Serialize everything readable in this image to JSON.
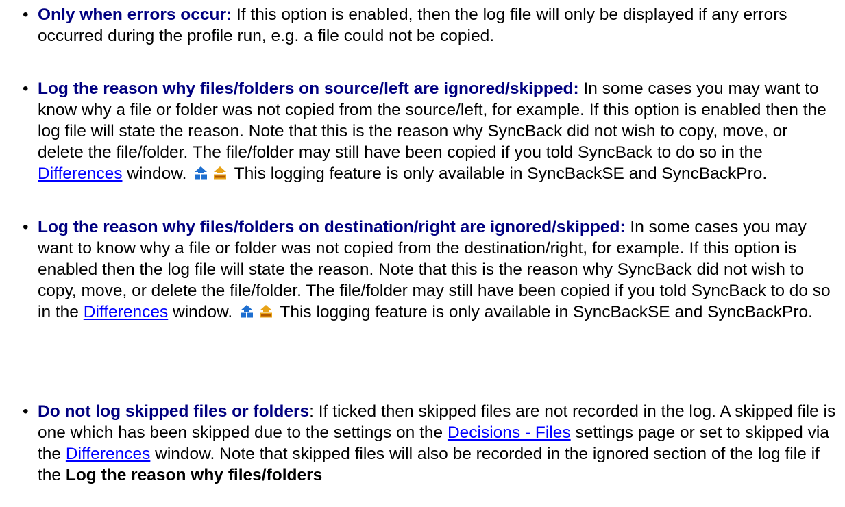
{
  "bullet_glyph": "•",
  "items": [
    {
      "term": "Only when errors occur:",
      "text1": " If this option is enabled, then the log file will only be displayed if any errors occurred during the profile run, e.g. a file could not be copied."
    },
    {
      "term": "Log the reason why files/folders on source/left are ignored/skipped:",
      "text1": " In some cases you may want to know why a file or folder was not copied from the source/left, for example. If this option is enabled then the log file will state the reason. Note that this is the reason why SyncBack did not wish to copy, move, or delete the file/folder. The file/folder may still have been copied if you told SyncBack to do so in the ",
      "link1": "Differences",
      "text2": " window. ",
      "text3": " This logging feature is only available in SyncBackSE and SyncBackPro."
    },
    {
      "term": "Log the reason why files/folders on destination/right are ignored/skipped:",
      "text1": " In some cases you may want to know why a file or folder was not copied from the destination/right, for example. If this option is enabled then the log file will state the reason. Note that this is the reason why SyncBack did not wish to copy, move, or delete the file/folder. The file/folder may still have been copied if you told SyncBack to do so in the ",
      "link1": "Differences",
      "text2": " window. ",
      "text3": " This logging feature is only available in SyncBackSE and SyncBackPro."
    },
    {
      "term": "Do not log skipped files or folders",
      "text1": ": If ticked then skipped files are not recorded in the log. A skipped file is one which has been skipped due to the settings on the ",
      "link1": "Decisions - Files",
      "text2": " settings page or set to skipped via the ",
      "link2": "Differences",
      "text3": " window. Note that skipped files will also be recorded in the ignored section of the log file if the ",
      "bold": "Log the reason why files/folders"
    }
  ],
  "icons": {
    "se": "syncback-se-icon",
    "pro": "syncback-pro-icon"
  },
  "colors": {
    "term": "#000080",
    "link": "#0000ff",
    "se_icon": "#1e6fd0",
    "pro_icon": "#e8a317"
  }
}
